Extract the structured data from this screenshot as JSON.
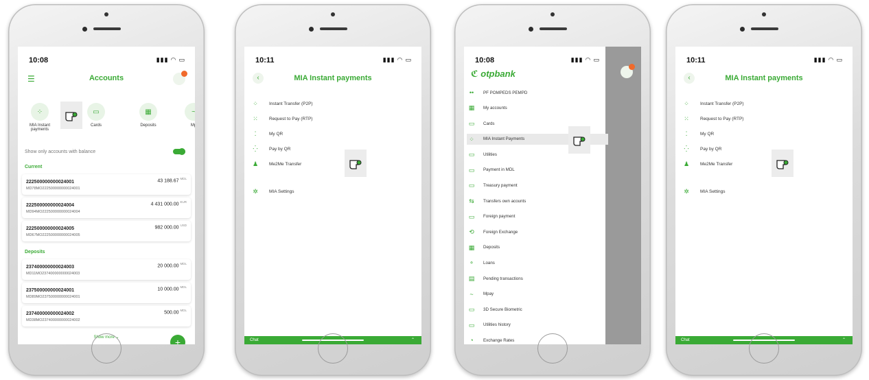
{
  "phone1": {
    "time": "10:08",
    "title": "Accounts",
    "quick_actions": [
      {
        "label": "MIA Instant payments",
        "icon": "mia-icon"
      },
      {
        "label": "Cards",
        "icon": "card-icon"
      },
      {
        "label": "Deposits",
        "icon": "deposit-icon"
      },
      {
        "label": "Mp",
        "icon": "mpay-icon"
      }
    ],
    "toggle_label": "Show only accounts with balance",
    "section_current": "Current",
    "current_accounts": [
      {
        "number": "222500000000024001",
        "iban": "MD78MO222500000000024001",
        "amount": "43 188.67",
        "currency": "MDL"
      },
      {
        "number": "222500000000024004",
        "iban": "MD94MO222500000000024004",
        "amount": "4 431 000.00",
        "currency": "EUR"
      },
      {
        "number": "222500000000024005",
        "iban": "MD67MO222500000000024005",
        "amount": "982 000.00",
        "currency": "USD"
      }
    ],
    "section_deposits": "Deposits",
    "deposit_accounts": [
      {
        "number": "237400000000024003",
        "iban": "MD11MO237400000000024003",
        "amount": "20 000.00",
        "currency": "MDL"
      },
      {
        "number": "237500000000024001",
        "iban": "MD89MO237500000000024001",
        "amount": "10 000.00",
        "currency": "MDL"
      },
      {
        "number": "237400000000024002",
        "iban": "MD38MO237400000000024002",
        "amount": "500.00",
        "currency": "MDL"
      }
    ],
    "show_more": "Show more",
    "fab": "+"
  },
  "phone2": {
    "time": "10:11",
    "title": "MIA Instant payments",
    "items": [
      "Instant Transfer (P2P)",
      "Request to Pay (RTP)",
      "My QR",
      "Pay by QR",
      "Me2Me Transfer"
    ],
    "settings": "MIA Settings",
    "chat": "Chat"
  },
  "phone3": {
    "time": "10:08",
    "logo": "otpbank",
    "user": "PF POMPEDS PEMPD",
    "menu": [
      "My accounts",
      "Cards",
      "MIA Instant Payments",
      "Utilities",
      "Payment in MDL",
      "Treasury payment",
      "Transfers own acounts",
      "Foreign payment",
      "Foreign Exchange",
      "Deposits",
      "Loans",
      "Pending transactions",
      "Mpay",
      "3D Secure Biometric",
      "Utilities history",
      "Exchange Rates"
    ],
    "selected_index": 2
  },
  "phone4": {
    "time": "10:11",
    "title": "MIA Instant payments",
    "items": [
      "Instant Transfer (P2P)",
      "Request to Pay (RTP)",
      "My QR",
      "Pay by QR",
      "Me2Me Transfer"
    ],
    "settings": "MIA Settings",
    "chat": "Chat"
  },
  "colors": {
    "accent": "#3aaa35",
    "badge": "#f06a2b",
    "overlay": "#9a9a9a"
  }
}
